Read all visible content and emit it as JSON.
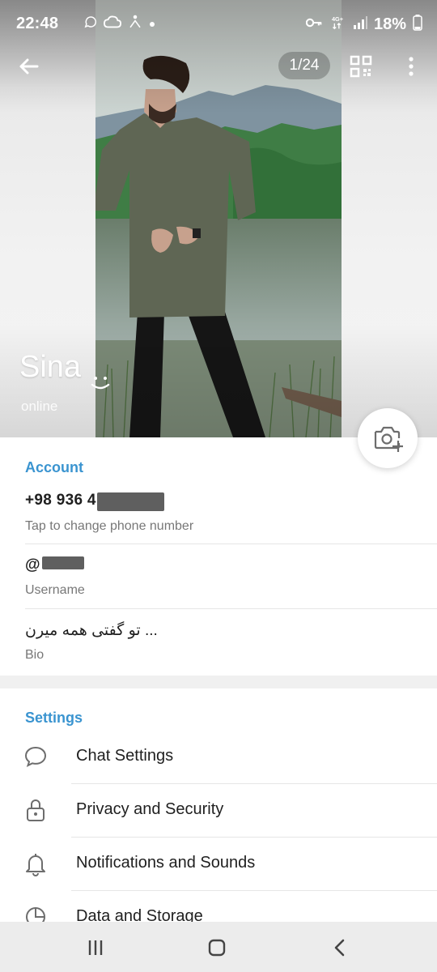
{
  "status_bar": {
    "time": "22:48",
    "battery": "18%",
    "network": "4G+",
    "left_icons": [
      "whatsapp-icon",
      "cloud-icon",
      "accessibility-icon",
      "dot-icon"
    ],
    "right_icons": [
      "key-icon",
      "network-icon",
      "signal-icon",
      "battery-icon"
    ]
  },
  "header": {
    "back_icon": "arrow-left-icon",
    "photo_counter": "1/24",
    "qr_icon": "qr-icon",
    "more_icon": "more-vertical-icon",
    "name": "Sina",
    "emoji": "smile-icon",
    "status": "online"
  },
  "camera_button": {
    "icon": "camera-add-icon"
  },
  "account": {
    "title": "Account",
    "phone": "+98 936 4",
    "phone_label": "Tap to change phone number",
    "username": "@",
    "username_label": "Username",
    "bio": "تو گفتی همه میرن ...",
    "bio_label": "Bio"
  },
  "settings": {
    "title": "Settings",
    "items": [
      {
        "label": "Chat Settings",
        "icon": "chat-icon"
      },
      {
        "label": "Privacy and Security",
        "icon": "lock-icon"
      },
      {
        "label": "Notifications and Sounds",
        "icon": "bell-icon"
      },
      {
        "label": "Data and Storage",
        "icon": "data-icon"
      }
    ]
  },
  "navbar": {
    "recent": "recent-apps-icon",
    "home": "home-icon",
    "back": "back-icon"
  },
  "colors": {
    "accent": "#3a94d0",
    "text": "#1f1f1f",
    "muted": "#777777",
    "divider": "#e6e6e6",
    "section_gap": "#f0f0f0"
  }
}
